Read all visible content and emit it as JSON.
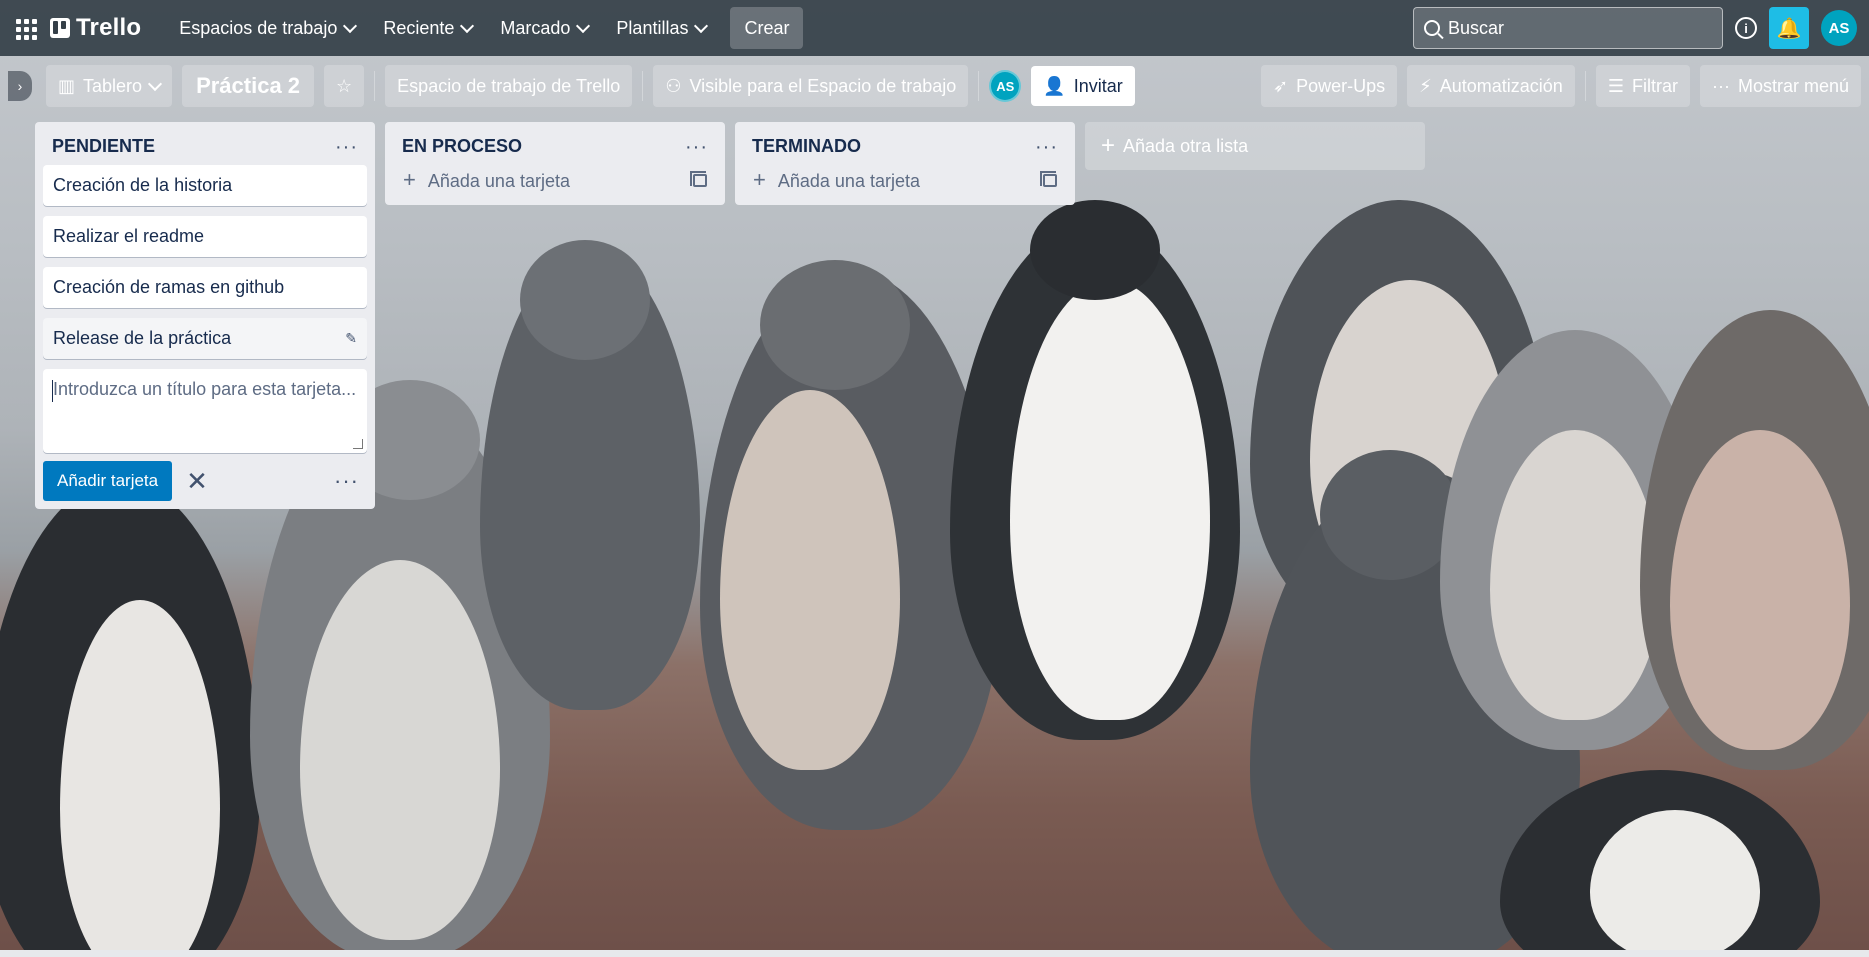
{
  "header": {
    "logo": "Trello",
    "nav": [
      {
        "label": "Espacios de trabajo"
      },
      {
        "label": "Reciente"
      },
      {
        "label": "Marcado"
      },
      {
        "label": "Plantillas"
      }
    ],
    "create_label": "Crear",
    "search_placeholder": "Buscar",
    "user_initials": "AS"
  },
  "board": {
    "view_label": "Tablero",
    "title": "Práctica 2",
    "workspace_label": "Espacio de trabajo de Trello",
    "visibility_label": "Visible para el Espacio de trabajo",
    "member_initials": "AS",
    "invite_label": "Invitar",
    "powerups_label": "Power-Ups",
    "automation_label": "Automatización",
    "filter_label": "Filtrar",
    "menu_label": "Mostrar menú"
  },
  "lists": [
    {
      "title": "PENDIENTE",
      "cards": [
        "Creación de la historia",
        "Realizar el readme",
        "Creación de ramas en github",
        "Release de la práctica"
      ],
      "composer_placeholder": "Introduzca un título para esta tarjeta...",
      "add_button_label": "Añadir tarjeta"
    },
    {
      "title": "EN PROCESO",
      "add_card_label": "Añada una tarjeta"
    },
    {
      "title": "TERMINADO",
      "add_card_label": "Añada una tarjeta"
    }
  ],
  "add_list_label": "Añada otra lista",
  "colors": {
    "topbar": "#343f48",
    "accent": "#0079bf",
    "notification": "#1ebde6",
    "avatar": "#00a3bf"
  }
}
